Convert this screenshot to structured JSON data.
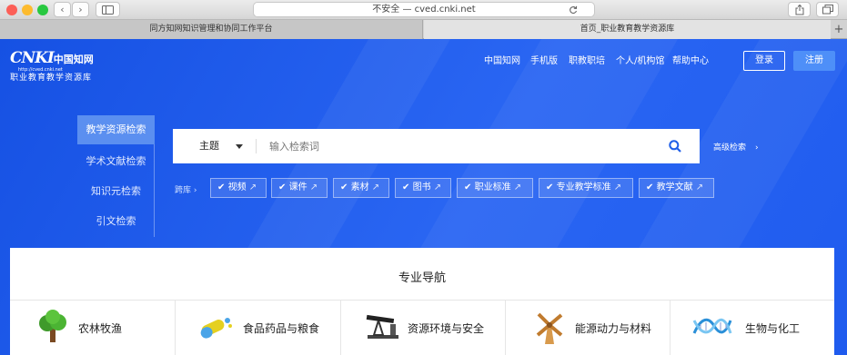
{
  "browser": {
    "url": "不安全 — cved.cnki.net",
    "back": "‹",
    "forward": "›",
    "tabs": [
      {
        "label": "同方知网知识管理和协同工作平台"
      },
      {
        "label": "首页_职业教育教学资源库"
      }
    ],
    "new_tab": "+"
  },
  "header": {
    "logo_sub": "http://cved.cnki.net",
    "logo_name": "职业教育教学资源库",
    "nav": [
      "中国知网",
      "手机版",
      "职教职培",
      "个人/机构馆",
      "帮助中心"
    ],
    "login": "登录",
    "register": "注册"
  },
  "side_tabs": [
    "教学资源检索",
    "学术文献检索",
    "知识元检索",
    "引文检索"
  ],
  "search": {
    "field": "主题",
    "placeholder": "输入检索词",
    "advanced": "高级检索"
  },
  "cross_label": "跨库",
  "chips": [
    "视频",
    "课件",
    "素材",
    "图书",
    "职业标准",
    "专业教学标准",
    "教学文献"
  ],
  "nav_section": {
    "title": "专业导航",
    "categories": [
      {
        "label": "农林牧渔",
        "icon": "tree-icon"
      },
      {
        "label": "食品药品与粮食",
        "icon": "pills-icon"
      },
      {
        "label": "资源环境与安全",
        "icon": "oil-pump-icon"
      },
      {
        "label": "能源动力与材料",
        "icon": "windmill-icon"
      },
      {
        "label": "生物与化工",
        "icon": "dna-icon"
      }
    ]
  }
}
